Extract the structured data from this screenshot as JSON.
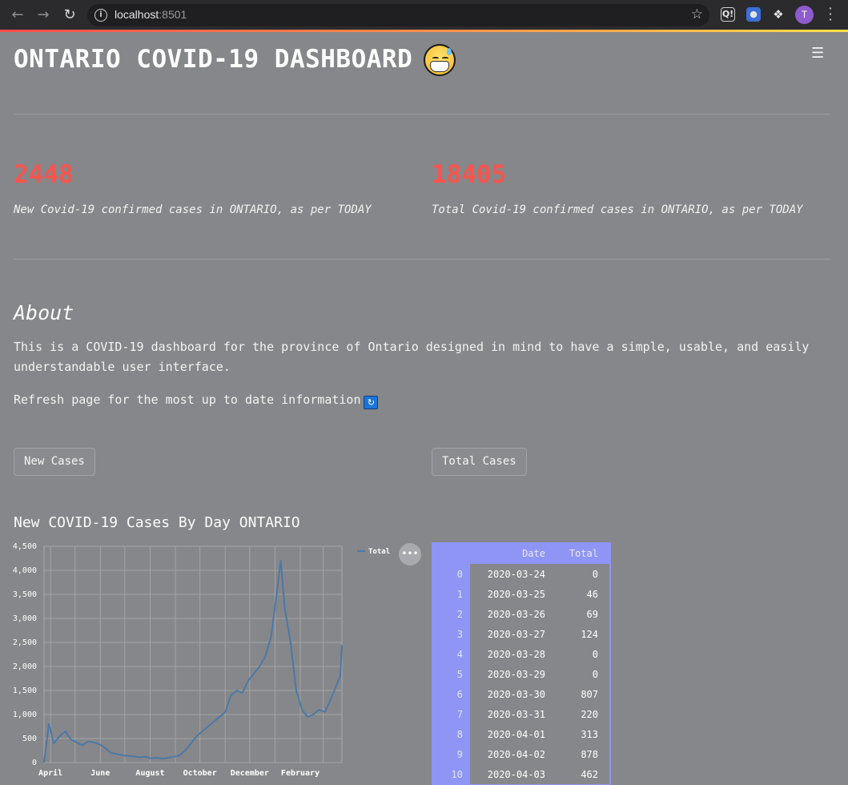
{
  "browser": {
    "url_host": "localhost",
    "url_port": ":8501",
    "avatar_initial": "T",
    "extensions": [
      "Q!",
      "extension-icon",
      "puzzle-icon"
    ]
  },
  "page": {
    "title": "ONTARIO COVID-19 DASHBOARD",
    "metrics": [
      {
        "value": "2448",
        "label": "New Covid-19 confirmed cases in ONTARIO, as per TODAY"
      },
      {
        "value": "18405",
        "label": "Total Covid-19 confirmed cases in ONTARIO, as per TODAY"
      }
    ],
    "about_heading": "About",
    "about_text": "This is a COVID-19 dashboard for the province of Ontario designed in mind to have a simple, usable, and easily understandable user interface.",
    "refresh_text": "Refresh page for the most up to date information",
    "buttons": {
      "new_cases": "New Cases",
      "total_cases": "Total Cases"
    },
    "chart_heading": "New COVID-19 Cases By Day ONTARIO",
    "more_label": "•••"
  },
  "table": {
    "columns": [
      "Date",
      "Total"
    ],
    "rows": [
      {
        "idx": "0",
        "date": "2020-03-24",
        "total": "0"
      },
      {
        "idx": "1",
        "date": "2020-03-25",
        "total": "46"
      },
      {
        "idx": "2",
        "date": "2020-03-26",
        "total": "69"
      },
      {
        "idx": "3",
        "date": "2020-03-27",
        "total": "124"
      },
      {
        "idx": "4",
        "date": "2020-03-28",
        "total": "0"
      },
      {
        "idx": "5",
        "date": "2020-03-29",
        "total": "0"
      },
      {
        "idx": "6",
        "date": "2020-03-30",
        "total": "807"
      },
      {
        "idx": "7",
        "date": "2020-03-31",
        "total": "220"
      },
      {
        "idx": "8",
        "date": "2020-04-01",
        "total": "313"
      },
      {
        "idx": "9",
        "date": "2020-04-02",
        "total": "878"
      },
      {
        "idx": "10",
        "date": "2020-04-03",
        "total": "462"
      }
    ]
  },
  "chart_data": {
    "type": "line",
    "x_tick_labels": [
      "April",
      "June",
      "August",
      "October",
      "December",
      "February"
    ],
    "y_ticks": [
      0,
      500,
      1000,
      1500,
      2000,
      2500,
      3000,
      3500,
      4000,
      4500
    ],
    "y_tick_labels": [
      "0",
      "500",
      "1,000",
      "1,500",
      "2,000",
      "2,500",
      "3,000",
      "3,500",
      "4,000",
      "4,500"
    ],
    "ylim": [
      0,
      4500
    ],
    "xlim": [
      "2020-03-24",
      "2021-03-24"
    ],
    "grid": true,
    "legend_position": "top-right",
    "line_color": "#4c78a8",
    "series": [
      {
        "name": "Total",
        "x": [
          "2020-03-24",
          "2020-03-30",
          "2020-04-05",
          "2020-04-12",
          "2020-04-19",
          "2020-04-26",
          "2020-05-03",
          "2020-05-10",
          "2020-05-17",
          "2020-05-24",
          "2020-05-31",
          "2020-06-07",
          "2020-06-14",
          "2020-06-21",
          "2020-06-28",
          "2020-07-05",
          "2020-07-12",
          "2020-07-19",
          "2020-07-26",
          "2020-08-02",
          "2020-08-09",
          "2020-08-16",
          "2020-08-23",
          "2020-08-30",
          "2020-09-06",
          "2020-09-13",
          "2020-09-20",
          "2020-09-27",
          "2020-10-04",
          "2020-10-11",
          "2020-10-18",
          "2020-10-25",
          "2020-11-01",
          "2020-11-08",
          "2020-11-15",
          "2020-11-22",
          "2020-11-29",
          "2020-12-06",
          "2020-12-13",
          "2020-12-20",
          "2020-12-27",
          "2021-01-03",
          "2021-01-08",
          "2021-01-13",
          "2021-01-20",
          "2021-01-27",
          "2021-02-03",
          "2021-02-10",
          "2021-02-17",
          "2021-02-24",
          "2021-03-03",
          "2021-03-10",
          "2021-03-17",
          "2021-03-22",
          "2021-03-24"
        ],
        "y": [
          0,
          807,
          400,
          550,
          650,
          480,
          420,
          360,
          440,
          420,
          380,
          300,
          200,
          180,
          150,
          140,
          130,
          110,
          120,
          90,
          100,
          80,
          100,
          120,
          150,
          250,
          400,
          550,
          650,
          750,
          850,
          950,
          1050,
          1400,
          1500,
          1450,
          1700,
          1850,
          2000,
          2200,
          2600,
          3500,
          4200,
          3200,
          2500,
          1500,
          1100,
          950,
          1000,
          1100,
          1050,
          1300,
          1600,
          1800,
          2448
        ]
      }
    ]
  }
}
